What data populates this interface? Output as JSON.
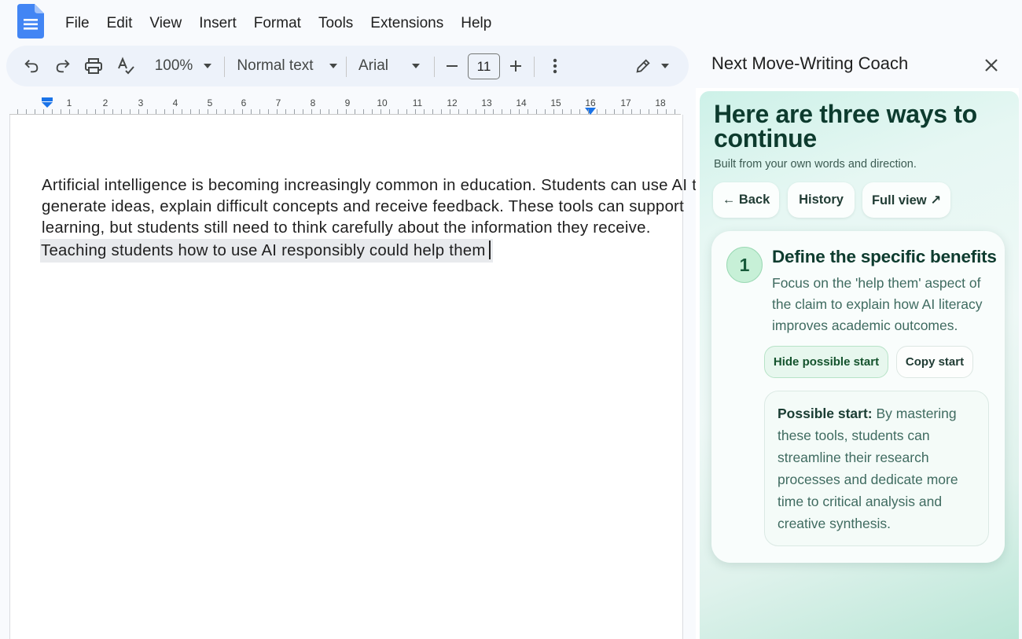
{
  "menu": {
    "items": [
      "File",
      "Edit",
      "View",
      "Insert",
      "Format",
      "Tools",
      "Extensions",
      "Help"
    ]
  },
  "toolbar": {
    "zoom": "100%",
    "style": "Normal text",
    "font": "Arial",
    "font_size": "11"
  },
  "ruler": {
    "numbers": [
      "1",
      "2",
      "3",
      "4",
      "5",
      "6",
      "7",
      "8",
      "9",
      "10",
      "11",
      "12",
      "13",
      "14",
      "15",
      "16",
      "17",
      "18"
    ]
  },
  "document": {
    "lines": [
      "Artificial intelligence is becoming increasingly common in education. Students can use AI to",
      "generate ideas, explain difficult concepts and receive feedback. These tools can support",
      "learning, but students still need to think carefully about the information they receive."
    ],
    "highlighted_line": "Teaching students how to use AI responsibly could help them"
  },
  "panel": {
    "title": "Next Move-Writing Coach",
    "heading": "Here are three ways to continue",
    "subheading": "Built from your own words and direction.",
    "buttons": {
      "back": "← Back",
      "history": "History",
      "full_view": "Full view ↗"
    },
    "card": {
      "number": "1",
      "title": "Define the specific benefits",
      "description": "Focus on the 'help them' aspect of the claim to explain how AI literacy improves academic outcomes.",
      "hide_button": "Hide possible start",
      "copy_button": "Copy start",
      "start_label": "Possible start:",
      "start_text": "By mastering these tools, students can streamline their research processes and dedicate more time to critical analysis and creative synthesis."
    }
  },
  "colors": {
    "docs_blue": "#4285f4",
    "toolbar_bg": "#edf2fa",
    "coach_heading": "#0d3b2e",
    "badge_green": "#c7f0d7"
  }
}
